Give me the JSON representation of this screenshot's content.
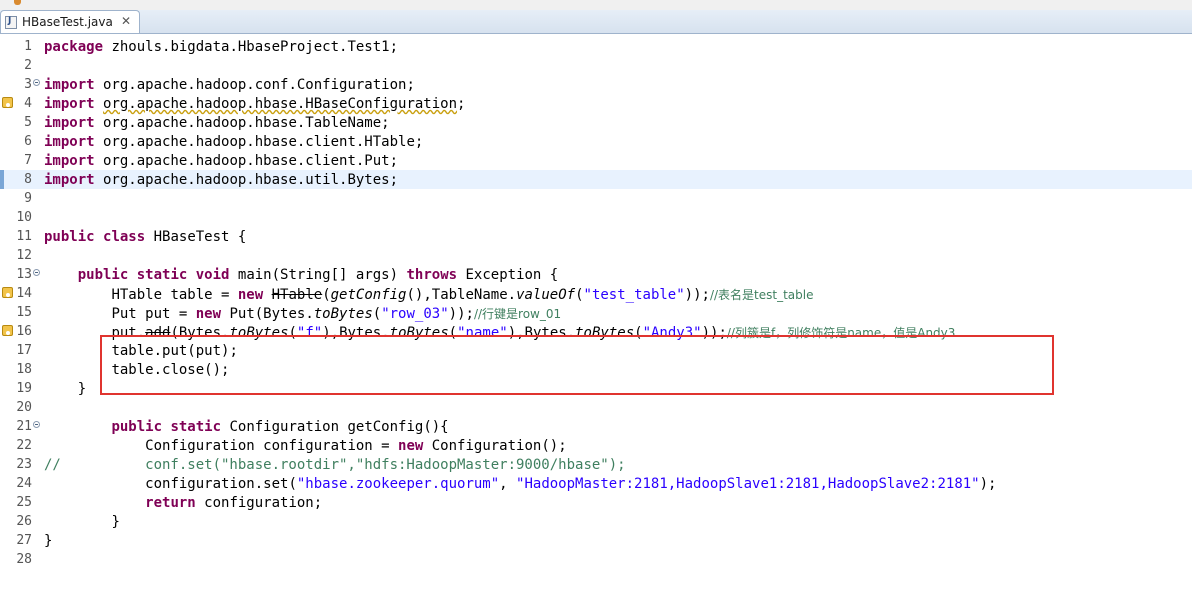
{
  "tab": {
    "title": "HBaseTest.java",
    "close_icon": "close-icon"
  },
  "lines": [
    {
      "n": "1"
    },
    {
      "n": "2"
    },
    {
      "n": "3"
    },
    {
      "n": "4"
    },
    {
      "n": "5"
    },
    {
      "n": "6"
    },
    {
      "n": "7"
    },
    {
      "n": "8"
    },
    {
      "n": "9"
    },
    {
      "n": "10"
    },
    {
      "n": "11"
    },
    {
      "n": "12"
    },
    {
      "n": "13"
    },
    {
      "n": "14"
    },
    {
      "n": "15"
    },
    {
      "n": "16"
    },
    {
      "n": "17"
    },
    {
      "n": "18"
    },
    {
      "n": "19"
    },
    {
      "n": "20"
    },
    {
      "n": "21"
    },
    {
      "n": "22"
    },
    {
      "n": "23"
    },
    {
      "n": "24"
    },
    {
      "n": "25"
    },
    {
      "n": "26"
    },
    {
      "n": "27"
    },
    {
      "n": "28"
    }
  ],
  "code": {
    "l1": {
      "kw": "package",
      "rest": " zhouls.bigdata.HbaseProject.Test1;"
    },
    "l3": {
      "kw": "import",
      "rest": " org.apache.hadoop.conf.Configuration;"
    },
    "l4": {
      "kw": "import",
      "pre": " ",
      "warn": "org.apache.hadoop.hbase.HBaseConfiguration",
      "rest": ";"
    },
    "l5": {
      "kw": "import",
      "rest": " org.apache.hadoop.hbase.TableName;"
    },
    "l6": {
      "kw": "import",
      "rest": " org.apache.hadoop.hbase.client.HTable;"
    },
    "l7": {
      "kw": "import",
      "rest": " org.apache.hadoop.hbase.client.Put;"
    },
    "l8": {
      "kw": "import",
      "rest": " org.apache.hadoop.hbase.util.Bytes;"
    },
    "l11": {
      "kw1": "public",
      "kw2": "class",
      "rest": " HBaseTest {"
    },
    "l13": {
      "indent": "    ",
      "kw1": "public",
      "kw2": "static",
      "kw3": "void",
      "mid": " main(String[] args) ",
      "kw4": "throws",
      "rest": " Exception {"
    },
    "l14": {
      "indent": "        ",
      "a": "HTable table = ",
      "kw": "new",
      "b": " ",
      "del": "HTable",
      "c": "(",
      "it1": "getConfig",
      "d": "(),TableName.",
      "it2": "valueOf",
      "e": "(",
      "str": "\"test_table\"",
      "f": "));",
      "cmt": "//表名是test_table"
    },
    "l15": {
      "indent": "        ",
      "a": "Put put = ",
      "kw": "new",
      "b": " Put(Bytes.",
      "it": "toBytes",
      "c": "(",
      "str": "\"row_03\"",
      "d": "));",
      "cmt": "//行键是row_01"
    },
    "l16": {
      "indent": "        ",
      "a": "put.",
      "del": "add",
      "b": "(Bytes.",
      "it1": "toBytes",
      "c": "(",
      "s1": "\"f\"",
      "d": "),Bytes.",
      "it2": "toBytes",
      "e": "(",
      "s2": "\"name\"",
      "f": "),Bytes.",
      "it3": "toBytes",
      "g": "(",
      "s3": "\"Andy3\"",
      "h": "));",
      "cmt": "//列簇是f，列修饰符是name，值是Andy3"
    },
    "l17": {
      "indent": "        ",
      "rest": "table.put(put);"
    },
    "l18": {
      "indent": "        ",
      "rest": "table.close();"
    },
    "l19": {
      "indent": "    ",
      "rest": "}"
    },
    "l21": {
      "indent": "        ",
      "kw1": "public",
      "kw2": "static",
      "rest": " Configuration getConfig(){"
    },
    "l22": {
      "indent": "            ",
      "a": "Configuration configuration = ",
      "kw": "new",
      "b": " Configuration();"
    },
    "l23": {
      "cmt": "//          conf.set(\"hbase.rootdir\",\"hdfs:HadoopMaster:9000/hbase\");"
    },
    "l24": {
      "indent": "            ",
      "a": "configuration.set(",
      "s1": "\"hbase.zookeeper.quorum\"",
      "b": ", ",
      "s2": "\"HadoopMaster:2181,HadoopSlave1:2181,HadoopSlave2:2181\"",
      "c": ");"
    },
    "l25": {
      "indent": "            ",
      "kw": "return",
      "rest": " configuration;"
    },
    "l26": {
      "indent": "        ",
      "rest": "}"
    },
    "l27": {
      "rest": "}"
    }
  }
}
